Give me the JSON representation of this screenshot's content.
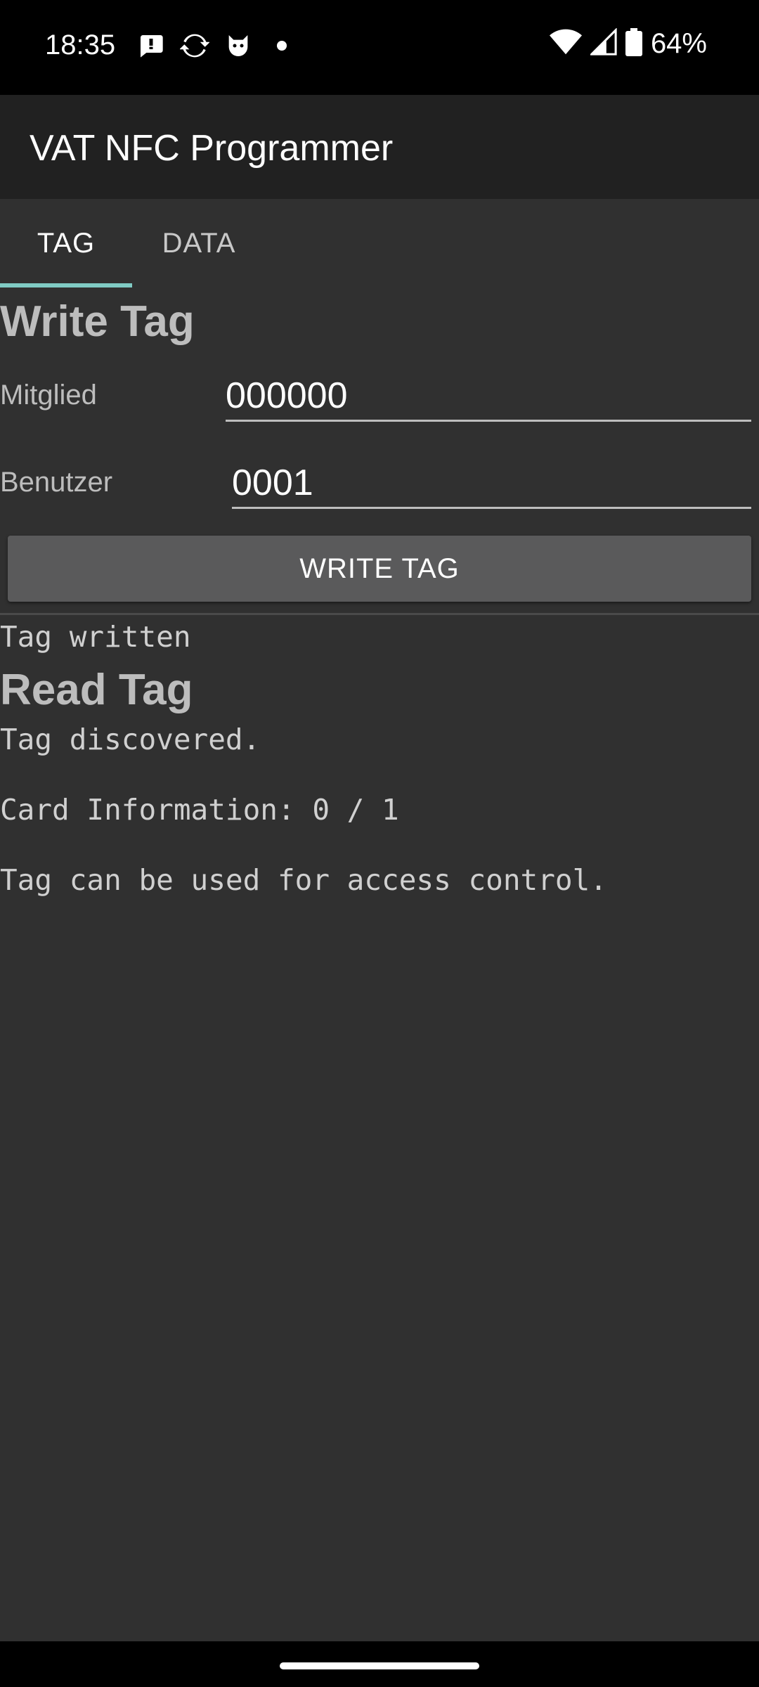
{
  "status_bar": {
    "time": "18:35",
    "icons": [
      "chat-bubble-icon",
      "sync-icon",
      "cat-icon",
      "dot-icon"
    ],
    "right_icons": [
      "wifi-icon",
      "cellular-signal-icon",
      "battery-icon"
    ],
    "battery_percent": "64%"
  },
  "app_bar": {
    "title": "VAT NFC Programmer"
  },
  "tabs": [
    {
      "label": "TAG",
      "selected": true
    },
    {
      "label": "DATA",
      "selected": false
    }
  ],
  "write_section": {
    "heading": "Write Tag",
    "member_label": "Mitglied",
    "member_value": "000000",
    "user_label": "Benutzer",
    "user_value": "0001",
    "button_label": "WRITE TAG",
    "result": "Tag written"
  },
  "read_section": {
    "heading": "Read Tag",
    "status": "Tag discovered.",
    "card_info": "Card Information: 0 / 1",
    "access_info": "Tag can be used for access control."
  },
  "colors": {
    "background": "#303030",
    "app_bar": "#212121",
    "tab_indicator": "#80cbc4",
    "button": "#5a5a5b"
  }
}
